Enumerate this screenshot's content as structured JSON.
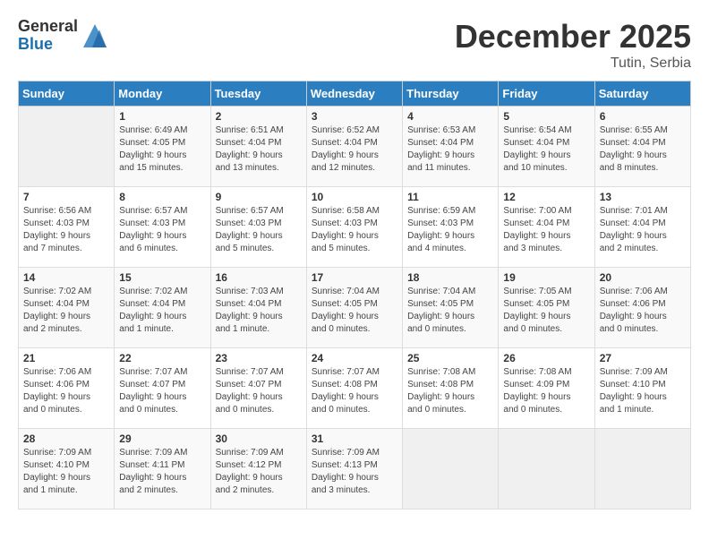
{
  "logo": {
    "general": "General",
    "blue": "Blue"
  },
  "title": "December 2025",
  "location": "Tutin, Serbia",
  "days_of_week": [
    "Sunday",
    "Monday",
    "Tuesday",
    "Wednesday",
    "Thursday",
    "Friday",
    "Saturday"
  ],
  "weeks": [
    [
      {
        "day": "",
        "info": ""
      },
      {
        "day": "1",
        "info": "Sunrise: 6:49 AM\nSunset: 4:05 PM\nDaylight: 9 hours\nand 15 minutes."
      },
      {
        "day": "2",
        "info": "Sunrise: 6:51 AM\nSunset: 4:04 PM\nDaylight: 9 hours\nand 13 minutes."
      },
      {
        "day": "3",
        "info": "Sunrise: 6:52 AM\nSunset: 4:04 PM\nDaylight: 9 hours\nand 12 minutes."
      },
      {
        "day": "4",
        "info": "Sunrise: 6:53 AM\nSunset: 4:04 PM\nDaylight: 9 hours\nand 11 minutes."
      },
      {
        "day": "5",
        "info": "Sunrise: 6:54 AM\nSunset: 4:04 PM\nDaylight: 9 hours\nand 10 minutes."
      },
      {
        "day": "6",
        "info": "Sunrise: 6:55 AM\nSunset: 4:04 PM\nDaylight: 9 hours\nand 8 minutes."
      }
    ],
    [
      {
        "day": "7",
        "info": "Sunrise: 6:56 AM\nSunset: 4:03 PM\nDaylight: 9 hours\nand 7 minutes."
      },
      {
        "day": "8",
        "info": "Sunrise: 6:57 AM\nSunset: 4:03 PM\nDaylight: 9 hours\nand 6 minutes."
      },
      {
        "day": "9",
        "info": "Sunrise: 6:57 AM\nSunset: 4:03 PM\nDaylight: 9 hours\nand 5 minutes."
      },
      {
        "day": "10",
        "info": "Sunrise: 6:58 AM\nSunset: 4:03 PM\nDaylight: 9 hours\nand 5 minutes."
      },
      {
        "day": "11",
        "info": "Sunrise: 6:59 AM\nSunset: 4:03 PM\nDaylight: 9 hours\nand 4 minutes."
      },
      {
        "day": "12",
        "info": "Sunrise: 7:00 AM\nSunset: 4:04 PM\nDaylight: 9 hours\nand 3 minutes."
      },
      {
        "day": "13",
        "info": "Sunrise: 7:01 AM\nSunset: 4:04 PM\nDaylight: 9 hours\nand 2 minutes."
      }
    ],
    [
      {
        "day": "14",
        "info": "Sunrise: 7:02 AM\nSunset: 4:04 PM\nDaylight: 9 hours\nand 2 minutes."
      },
      {
        "day": "15",
        "info": "Sunrise: 7:02 AM\nSunset: 4:04 PM\nDaylight: 9 hours\nand 1 minute."
      },
      {
        "day": "16",
        "info": "Sunrise: 7:03 AM\nSunset: 4:04 PM\nDaylight: 9 hours\nand 1 minute."
      },
      {
        "day": "17",
        "info": "Sunrise: 7:04 AM\nSunset: 4:05 PM\nDaylight: 9 hours\nand 0 minutes."
      },
      {
        "day": "18",
        "info": "Sunrise: 7:04 AM\nSunset: 4:05 PM\nDaylight: 9 hours\nand 0 minutes."
      },
      {
        "day": "19",
        "info": "Sunrise: 7:05 AM\nSunset: 4:05 PM\nDaylight: 9 hours\nand 0 minutes."
      },
      {
        "day": "20",
        "info": "Sunrise: 7:06 AM\nSunset: 4:06 PM\nDaylight: 9 hours\nand 0 minutes."
      }
    ],
    [
      {
        "day": "21",
        "info": "Sunrise: 7:06 AM\nSunset: 4:06 PM\nDaylight: 9 hours\nand 0 minutes."
      },
      {
        "day": "22",
        "info": "Sunrise: 7:07 AM\nSunset: 4:07 PM\nDaylight: 9 hours\nand 0 minutes."
      },
      {
        "day": "23",
        "info": "Sunrise: 7:07 AM\nSunset: 4:07 PM\nDaylight: 9 hours\nand 0 minutes."
      },
      {
        "day": "24",
        "info": "Sunrise: 7:07 AM\nSunset: 4:08 PM\nDaylight: 9 hours\nand 0 minutes."
      },
      {
        "day": "25",
        "info": "Sunrise: 7:08 AM\nSunset: 4:08 PM\nDaylight: 9 hours\nand 0 minutes."
      },
      {
        "day": "26",
        "info": "Sunrise: 7:08 AM\nSunset: 4:09 PM\nDaylight: 9 hours\nand 0 minutes."
      },
      {
        "day": "27",
        "info": "Sunrise: 7:09 AM\nSunset: 4:10 PM\nDaylight: 9 hours\nand 1 minute."
      }
    ],
    [
      {
        "day": "28",
        "info": "Sunrise: 7:09 AM\nSunset: 4:10 PM\nDaylight: 9 hours\nand 1 minute."
      },
      {
        "day": "29",
        "info": "Sunrise: 7:09 AM\nSunset: 4:11 PM\nDaylight: 9 hours\nand 2 minutes."
      },
      {
        "day": "30",
        "info": "Sunrise: 7:09 AM\nSunset: 4:12 PM\nDaylight: 9 hours\nand 2 minutes."
      },
      {
        "day": "31",
        "info": "Sunrise: 7:09 AM\nSunset: 4:13 PM\nDaylight: 9 hours\nand 3 minutes."
      },
      {
        "day": "",
        "info": ""
      },
      {
        "day": "",
        "info": ""
      },
      {
        "day": "",
        "info": ""
      }
    ]
  ]
}
